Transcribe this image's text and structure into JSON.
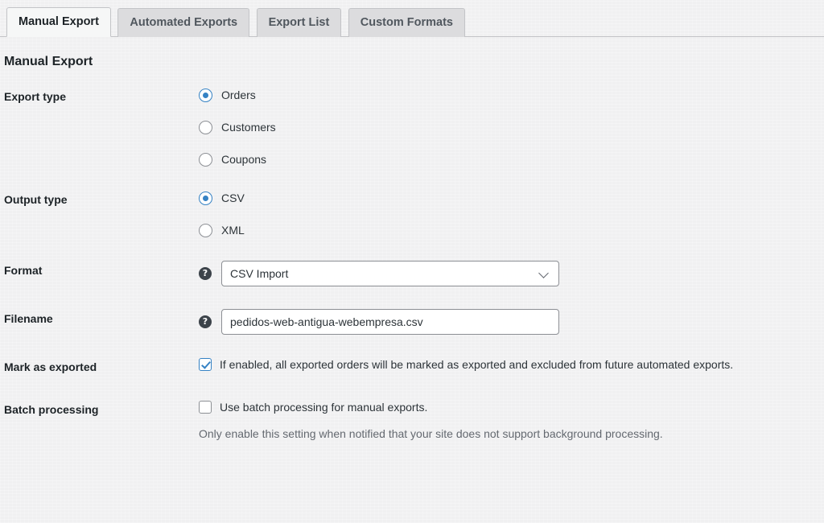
{
  "tabs": [
    {
      "label": "Manual Export",
      "active": true
    },
    {
      "label": "Automated Exports",
      "active": false
    },
    {
      "label": "Export List",
      "active": false
    },
    {
      "label": "Custom Formats",
      "active": false
    }
  ],
  "heading": "Manual Export",
  "fields": {
    "export_type": {
      "label": "Export type",
      "options": [
        {
          "label": "Orders",
          "checked": true
        },
        {
          "label": "Customers",
          "checked": false
        },
        {
          "label": "Coupons",
          "checked": false
        }
      ]
    },
    "output_type": {
      "label": "Output type",
      "options": [
        {
          "label": "CSV",
          "checked": true
        },
        {
          "label": "XML",
          "checked": false
        }
      ]
    },
    "format": {
      "label": "Format",
      "help": "?",
      "value": "CSV Import",
      "chevron": "chevron-down-icon"
    },
    "filename": {
      "label": "Filename",
      "help": "?",
      "value": "pedidos-web-antigua-webempresa.csv",
      "placeholder": ""
    },
    "mark_as_exported": {
      "label": "Mark as exported",
      "checked": true,
      "text": "If enabled, all exported orders will be marked as exported and excluded from future automated exports."
    },
    "batch_processing": {
      "label": "Batch processing",
      "checked": false,
      "text": "Use batch processing for manual exports.",
      "description": "Only enable this setting when notified that your site does not support background processing."
    }
  },
  "colors": {
    "accent": "#3582c4",
    "page_bg": "#f0f0f1",
    "tab_inactive_bg": "#dcdcde",
    "tab_active_bg": "#f6f7f7",
    "border": "#c3c4c7",
    "text": "#1d2327",
    "muted_text": "#646970",
    "helptip_bg": "#3c434a"
  }
}
